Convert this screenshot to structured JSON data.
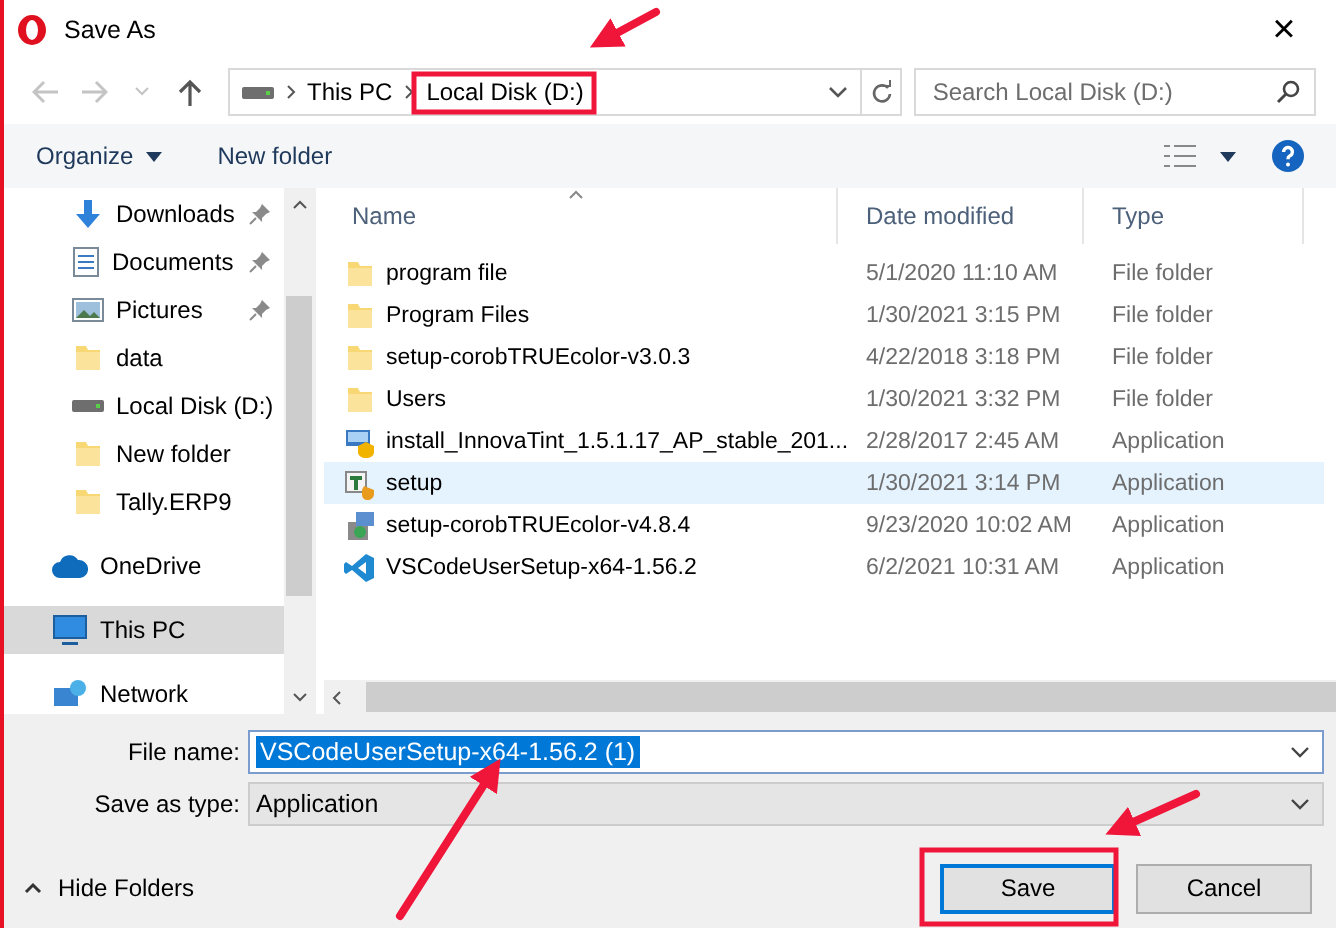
{
  "window": {
    "title": "Save As",
    "close": "×"
  },
  "nav": {
    "breadcrumb": [
      "This PC",
      "Local Disk (D:)"
    ],
    "search": {
      "placeholder": "Search Local Disk (D:)"
    }
  },
  "toolbar": {
    "organize": "Organize",
    "new_folder": "New folder"
  },
  "sidebar": {
    "groups": [
      {
        "items": [
          {
            "label": "Downloads",
            "kind": "downloads",
            "pinned": true,
            "selected": false
          },
          {
            "label": "Documents",
            "kind": "documents",
            "pinned": true,
            "selected": false
          },
          {
            "label": "Pictures",
            "kind": "pictures",
            "pinned": true,
            "selected": false
          },
          {
            "label": "data",
            "kind": "folder",
            "pinned": false,
            "selected": false
          },
          {
            "label": "Local Disk (D:)",
            "kind": "drive",
            "pinned": false,
            "selected": false
          },
          {
            "label": "New folder",
            "kind": "folder",
            "pinned": false,
            "selected": false
          },
          {
            "label": "Tally.ERP9",
            "kind": "folder",
            "pinned": false,
            "selected": false
          }
        ]
      },
      {
        "items": [
          {
            "label": "OneDrive",
            "kind": "cloud",
            "pinned": false,
            "selected": false
          }
        ]
      },
      {
        "items": [
          {
            "label": "This PC",
            "kind": "pc",
            "pinned": false,
            "selected": true
          }
        ]
      },
      {
        "items": [
          {
            "label": "Network",
            "kind": "network",
            "pinned": false,
            "selected": false
          }
        ]
      }
    ]
  },
  "table": {
    "columns": [
      "Name",
      "Date modified",
      "Type"
    ],
    "rows": [
      {
        "name": "program file",
        "date": "5/1/2020 11:10 AM",
        "type": "File folder",
        "kind": "folder",
        "selected": false
      },
      {
        "name": "Program Files",
        "date": "1/30/2021 3:15 PM",
        "type": "File folder",
        "kind": "folder",
        "selected": false
      },
      {
        "name": "setup-corobTRUEcolor-v3.0.3",
        "date": "4/22/2018 3:18 PM",
        "type": "File folder",
        "kind": "folder",
        "selected": false
      },
      {
        "name": "Users",
        "date": "1/30/2021 3:32 PM",
        "type": "File folder",
        "kind": "folder",
        "selected": false
      },
      {
        "name": "install_InnovaTint_1.5.1.17_AP_stable_201...",
        "date": "2/28/2017 2:45 AM",
        "type": "Application",
        "kind": "installer",
        "selected": false
      },
      {
        "name": "setup",
        "date": "1/30/2021 3:14 PM",
        "type": "Application",
        "kind": "setup",
        "selected": true
      },
      {
        "name": "setup-corobTRUEcolor-v4.8.4",
        "date": "9/23/2020 10:02 AM",
        "type": "Application",
        "kind": "package",
        "selected": false
      },
      {
        "name": "VSCodeUserSetup-x64-1.56.2",
        "date": "6/2/2021 10:31 AM",
        "type": "Application",
        "kind": "vscode",
        "selected": false
      }
    ]
  },
  "form": {
    "file_name": {
      "label": "File name:",
      "value": "VSCodeUserSetup-x64-1.56.2 (1)"
    },
    "save_as_type": {
      "label": "Save as type:",
      "value": "Application"
    }
  },
  "footer": {
    "hide_folders": "Hide Folders",
    "buttons": [
      {
        "label": "Save",
        "kind": "default"
      },
      {
        "label": "Cancel",
        "kind": "normal"
      }
    ]
  }
}
